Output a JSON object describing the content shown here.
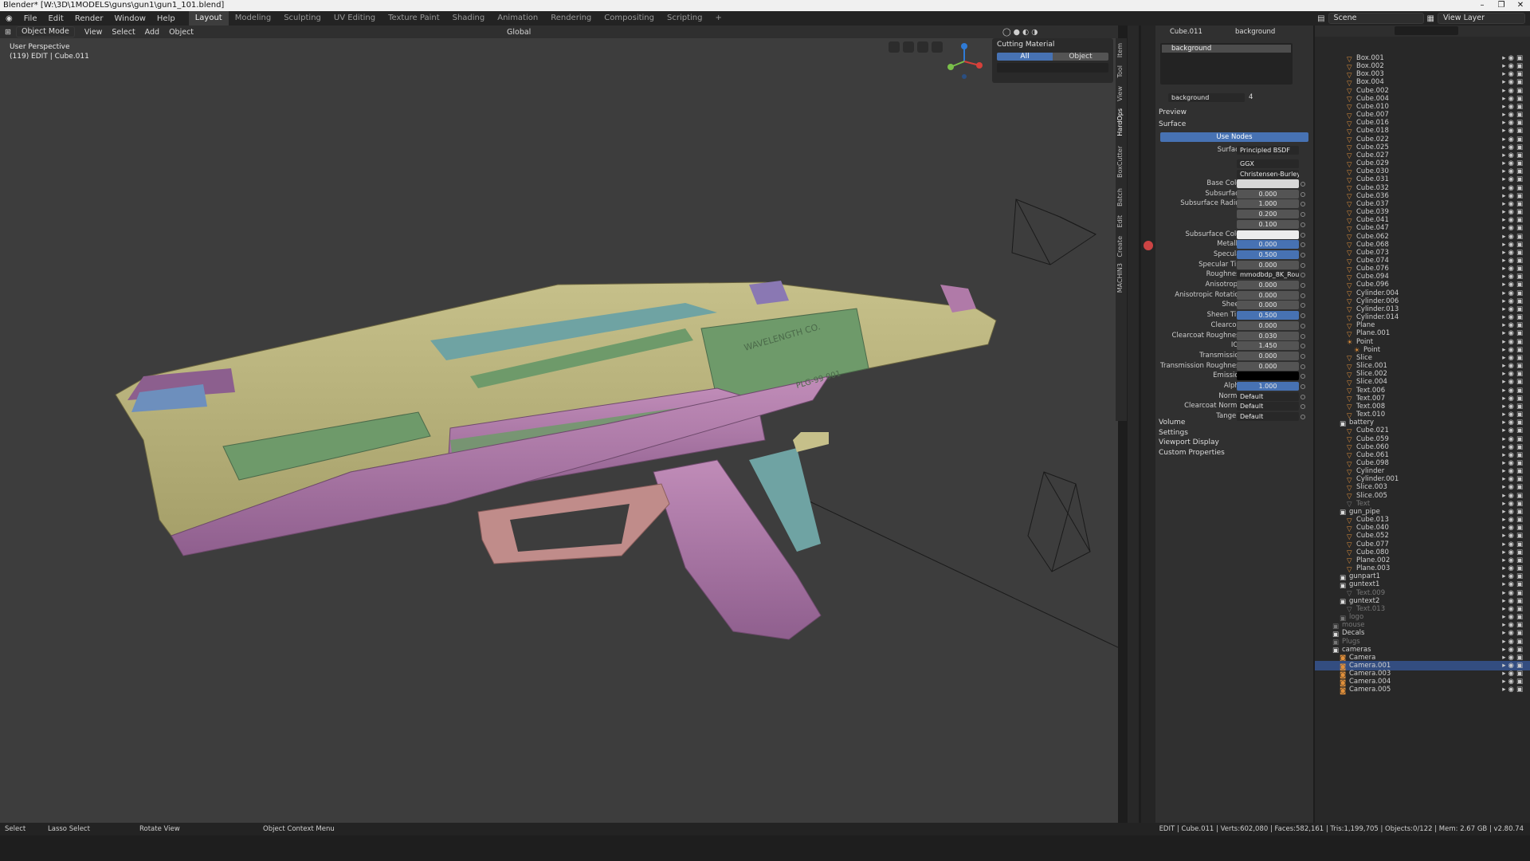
{
  "window": {
    "title": "Blender* [W:\\3D\\1MODELS\\guns\\gun1\\gun1_101.blend]",
    "controls": [
      "–",
      "❐",
      "✕"
    ]
  },
  "menu": [
    "File",
    "Edit",
    "Render",
    "Window",
    "Help"
  ],
  "workspaces": [
    "Layout",
    "Modeling",
    "Sculpting",
    "UV Editing",
    "Texture Paint",
    "Shading",
    "Animation",
    "Rendering",
    "Compositing",
    "Scripting",
    "+"
  ],
  "scene": {
    "scene": "Scene",
    "view_layer": "View Layer"
  },
  "viewport": {
    "mode": "Object Mode",
    "menus": [
      "View",
      "Select",
      "Add",
      "Object"
    ],
    "orientation": "Global",
    "info_line1": "User Perspective",
    "info_line2": "(119) EDIT | Cube.011"
  },
  "npanel": {
    "title": "Cutting Material",
    "tab_all": "All",
    "tab_object": "Object"
  },
  "side_tabs": [
    "Item",
    "Tool",
    "View",
    "HardOps",
    "BoxCutter",
    "Batch",
    "Edit",
    "Create",
    "MACHIN3"
  ],
  "model": {
    "brand": "WAVELENGTH CO.",
    "serial": "PLG-99 001"
  },
  "properties": {
    "object": "Cube.011",
    "material": "background",
    "slot": "background",
    "mat_name": "background",
    "users": "4",
    "preview": "Preview",
    "surface_section": "Surface",
    "use_nodes": "Use Nodes",
    "surface_label": "Surface",
    "surface_value": "Principled BSDF",
    "distribution": "GGX",
    "sss_method": "Christensen-Burley",
    "fields": [
      {
        "label": "Base Color",
        "value": "",
        "kind": "color",
        "color": "#d8d8d8"
      },
      {
        "label": "Subsurface",
        "value": "0.000",
        "kind": "num"
      },
      {
        "label": "Subsurface Radius",
        "value": "1.000",
        "kind": "num"
      },
      {
        "label": "",
        "value": "0.200",
        "kind": "num"
      },
      {
        "label": "",
        "value": "0.100",
        "kind": "num"
      },
      {
        "label": "Subsurface Color",
        "value": "",
        "kind": "color",
        "color": "#ececec"
      },
      {
        "label": "Metallic",
        "value": "0.000",
        "kind": "blue"
      },
      {
        "label": "Specular",
        "value": "0.500",
        "kind": "blue"
      },
      {
        "label": "Specular Tint",
        "value": "0.000",
        "kind": "num"
      },
      {
        "label": "Roughness",
        "value": "mmodbdp_8K_Roug...",
        "kind": "dd"
      },
      {
        "label": "Anisotropic",
        "value": "0.000",
        "kind": "num"
      },
      {
        "label": "Anisotropic Rotation",
        "value": "0.000",
        "kind": "num"
      },
      {
        "label": "Sheen",
        "value": "0.000",
        "kind": "num"
      },
      {
        "label": "Sheen Tint",
        "value": "0.500",
        "kind": "blue"
      },
      {
        "label": "Clearcoat",
        "value": "0.000",
        "kind": "num"
      },
      {
        "label": "Clearcoat Roughness",
        "value": "0.030",
        "kind": "num"
      },
      {
        "label": "IOR",
        "value": "1.450",
        "kind": "num"
      },
      {
        "label": "Transmission",
        "value": "0.000",
        "kind": "num"
      },
      {
        "label": "Transmission Roughness",
        "value": "0.000",
        "kind": "num"
      },
      {
        "label": "Emission",
        "value": "",
        "kind": "color",
        "color": "#000000"
      },
      {
        "label": "Alpha",
        "value": "1.000",
        "kind": "blue"
      },
      {
        "label": "Normal",
        "value": "Default",
        "kind": "dd"
      },
      {
        "label": "Clearcoat Normal",
        "value": "Default",
        "kind": "dd"
      },
      {
        "label": "Tangent",
        "value": "Default",
        "kind": "dd"
      }
    ],
    "sections": [
      "Volume",
      "Settings",
      "Viewport Display",
      "Custom Properties"
    ]
  },
  "outliner": [
    {
      "n": "Box.001",
      "d": 2,
      "t": "mesh"
    },
    {
      "n": "Box.002",
      "d": 2,
      "t": "mesh"
    },
    {
      "n": "Box.003",
      "d": 2,
      "t": "mesh"
    },
    {
      "n": "Box.004",
      "d": 2,
      "t": "mesh"
    },
    {
      "n": "Cube.002",
      "d": 2,
      "t": "mesh"
    },
    {
      "n": "Cube.004",
      "d": 2,
      "t": "mesh"
    },
    {
      "n": "Cube.010",
      "d": 2,
      "t": "mesh"
    },
    {
      "n": "Cube.007",
      "d": 2,
      "t": "mesh"
    },
    {
      "n": "Cube.016",
      "d": 2,
      "t": "mesh"
    },
    {
      "n": "Cube.018",
      "d": 2,
      "t": "mesh"
    },
    {
      "n": "Cube.022",
      "d": 2,
      "t": "mesh"
    },
    {
      "n": "Cube.025",
      "d": 2,
      "t": "mesh"
    },
    {
      "n": "Cube.027",
      "d": 2,
      "t": "mesh"
    },
    {
      "n": "Cube.029",
      "d": 2,
      "t": "mesh"
    },
    {
      "n": "Cube.030",
      "d": 2,
      "t": "mesh"
    },
    {
      "n": "Cube.031",
      "d": 2,
      "t": "mesh"
    },
    {
      "n": "Cube.032",
      "d": 2,
      "t": "mesh"
    },
    {
      "n": "Cube.036",
      "d": 2,
      "t": "mesh"
    },
    {
      "n": "Cube.037",
      "d": 2,
      "t": "mesh"
    },
    {
      "n": "Cube.039",
      "d": 2,
      "t": "mesh"
    },
    {
      "n": "Cube.041",
      "d": 2,
      "t": "mesh"
    },
    {
      "n": "Cube.047",
      "d": 2,
      "t": "mesh"
    },
    {
      "n": "Cube.062",
      "d": 2,
      "t": "mesh"
    },
    {
      "n": "Cube.068",
      "d": 2,
      "t": "mesh"
    },
    {
      "n": "Cube.073",
      "d": 2,
      "t": "mesh"
    },
    {
      "n": "Cube.074",
      "d": 2,
      "t": "mesh"
    },
    {
      "n": "Cube.076",
      "d": 2,
      "t": "mesh"
    },
    {
      "n": "Cube.094",
      "d": 2,
      "t": "mesh"
    },
    {
      "n": "Cube.096",
      "d": 2,
      "t": "mesh"
    },
    {
      "n": "Cylinder.004",
      "d": 2,
      "t": "mesh"
    },
    {
      "n": "Cylinder.006",
      "d": 2,
      "t": "mesh"
    },
    {
      "n": "Cylinder.013",
      "d": 2,
      "t": "mesh"
    },
    {
      "n": "Cylinder.014",
      "d": 2,
      "t": "mesh"
    },
    {
      "n": "Plane",
      "d": 2,
      "t": "mesh"
    },
    {
      "n": "Plane.001",
      "d": 2,
      "t": "mesh"
    },
    {
      "n": "Point",
      "d": 2,
      "t": "light"
    },
    {
      "n": "Point",
      "d": 3,
      "t": "light"
    },
    {
      "n": "Slice",
      "d": 2,
      "t": "mesh"
    },
    {
      "n": "Slice.001",
      "d": 2,
      "t": "mesh"
    },
    {
      "n": "Slice.002",
      "d": 2,
      "t": "mesh"
    },
    {
      "n": "Slice.004",
      "d": 2,
      "t": "mesh"
    },
    {
      "n": "Text.006",
      "d": 2,
      "t": "mesh"
    },
    {
      "n": "Text.007",
      "d": 2,
      "t": "mesh"
    },
    {
      "n": "Text.008",
      "d": 2,
      "t": "mesh"
    },
    {
      "n": "Text.010",
      "d": 2,
      "t": "mesh"
    },
    {
      "n": "battery",
      "d": 1,
      "t": "coll"
    },
    {
      "n": "Cube.021",
      "d": 2,
      "t": "mesh"
    },
    {
      "n": "Cube.059",
      "d": 2,
      "t": "mesh"
    },
    {
      "n": "Cube.060",
      "d": 2,
      "t": "mesh"
    },
    {
      "n": "Cube.061",
      "d": 2,
      "t": "mesh"
    },
    {
      "n": "Cube.098",
      "d": 2,
      "t": "mesh"
    },
    {
      "n": "Cylinder",
      "d": 2,
      "t": "mesh"
    },
    {
      "n": "Cylinder.001",
      "d": 2,
      "t": "mesh"
    },
    {
      "n": "Slice.003",
      "d": 2,
      "t": "mesh"
    },
    {
      "n": "Slice.005",
      "d": 2,
      "t": "mesh"
    },
    {
      "n": "Text",
      "d": 2,
      "t": "dim"
    },
    {
      "n": "gun_pipe",
      "d": 1,
      "t": "coll"
    },
    {
      "n": "Cube.013",
      "d": 2,
      "t": "mesh"
    },
    {
      "n": "Cube.040",
      "d": 2,
      "t": "mesh"
    },
    {
      "n": "Cube.052",
      "d": 2,
      "t": "mesh"
    },
    {
      "n": "Cube.077",
      "d": 2,
      "t": "mesh"
    },
    {
      "n": "Cube.080",
      "d": 2,
      "t": "mesh"
    },
    {
      "n": "Plane.002",
      "d": 2,
      "t": "mesh"
    },
    {
      "n": "Plane.003",
      "d": 2,
      "t": "mesh"
    },
    {
      "n": "gunpart1",
      "d": 1,
      "t": "coll"
    },
    {
      "n": "guntext1",
      "d": 1,
      "t": "coll"
    },
    {
      "n": "Text.009",
      "d": 2,
      "t": "dim"
    },
    {
      "n": "guntext2",
      "d": 1,
      "t": "coll"
    },
    {
      "n": "Text.013",
      "d": 2,
      "t": "dim"
    },
    {
      "n": "logo",
      "d": 1,
      "t": "dimcoll"
    },
    {
      "n": "mouse",
      "d": 0,
      "t": "dimcoll"
    },
    {
      "n": "Decals",
      "d": 0,
      "t": "coll"
    },
    {
      "n": "Plugs",
      "d": 0,
      "t": "dimcoll"
    },
    {
      "n": "cameras",
      "d": 0,
      "t": "coll"
    },
    {
      "n": "Camera",
      "d": 1,
      "t": "cam"
    },
    {
      "n": "Camera.001",
      "d": 1,
      "t": "cam",
      "sel": true
    },
    {
      "n": "Camera.003",
      "d": 1,
      "t": "cam"
    },
    {
      "n": "Camera.004",
      "d": 1,
      "t": "cam"
    },
    {
      "n": "Camera.005",
      "d": 1,
      "t": "cam"
    }
  ],
  "status": {
    "select": "Select",
    "lasso": "Lasso Select",
    "rotate": "Rotate View",
    "context": "Object Context Menu",
    "stats": "EDIT | Cube.011 | Verts:602,080 | Faces:582,161 | Tris:1,199,705 | Objects:0/122 | Mem: 2.67 GB | v2.80.74"
  },
  "colors": {
    "accent": "#4772b3",
    "viewport_bg": "#3d3d3d",
    "gun_yellow": "#b8b27a",
    "gun_green": "#6e9a6a",
    "gun_pink": "#b07aa8",
    "gun_teal": "#6fa3a3",
    "gun_purple": "#8c5f8e"
  }
}
